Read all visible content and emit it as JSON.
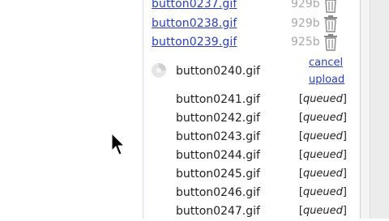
{
  "completed": [
    {
      "name": "button0237.gif",
      "size": "929b"
    },
    {
      "name": "button0238.gif",
      "size": "929b"
    },
    {
      "name": "button0239.gif",
      "size": "925b"
    }
  ],
  "active": {
    "name": "button0240.gif",
    "cancel_label": "cancel",
    "upload_label": "upload"
  },
  "queue": [
    {
      "name": "button0241.gif",
      "status": "queued"
    },
    {
      "name": "button0242.gif",
      "status": "queued"
    },
    {
      "name": "button0243.gif",
      "status": "queued"
    },
    {
      "name": "button0244.gif",
      "status": "queued"
    },
    {
      "name": "button0245.gif",
      "status": "queued"
    },
    {
      "name": "button0246.gif",
      "status": "queued"
    },
    {
      "name": "button0247.gif",
      "status": "queued"
    }
  ],
  "icons": {
    "delete": "trash-icon",
    "progress": "spinner-icon",
    "pointer": "mouse-cursor-icon"
  },
  "colors": {
    "link": "#2a3fb8",
    "muted": "#a8a8a8",
    "text": "#222222"
  }
}
